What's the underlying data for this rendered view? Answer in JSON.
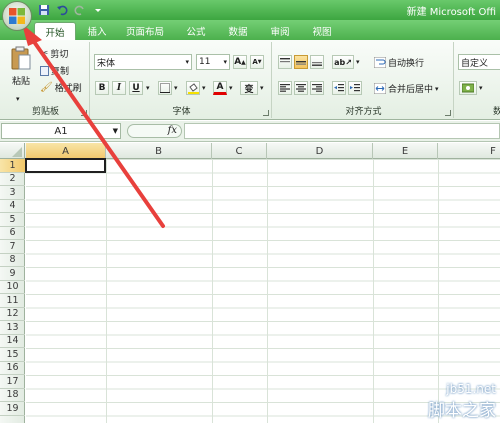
{
  "window": {
    "title": "新建 Microsoft Offi"
  },
  "tabs": [
    "开始",
    "插入",
    "页面布局",
    "公式",
    "数据",
    "审阅",
    "视图"
  ],
  "clipboard": {
    "paste": "粘贴",
    "cut": "剪切",
    "copy": "复制",
    "format_painter": "格式刷",
    "group": "剪贴板"
  },
  "font": {
    "name": "宋体",
    "size": "11",
    "bold": "B",
    "italic": "I",
    "underline": "U",
    "grow": "A",
    "shrink": "A",
    "font_color": "A",
    "phonetic": "变",
    "group": "字体"
  },
  "alignment": {
    "wrap_text": "自动换行",
    "merge_center": "合并后居中",
    "group": "对齐方式"
  },
  "number": {
    "format": "自定义",
    "group": "数"
  },
  "formula_bar": {
    "name_box": "A1",
    "fx": "fx"
  },
  "columns": [
    "A",
    "B",
    "C",
    "D",
    "E",
    "F"
  ],
  "rows": [
    "1",
    "2",
    "3",
    "4",
    "5",
    "6",
    "7",
    "8",
    "9",
    "10",
    "11",
    "12",
    "13",
    "14",
    "15",
    "16",
    "17",
    "18",
    "19"
  ],
  "watermark": {
    "site": "jb51.net",
    "name": "脚本之家"
  },
  "colors": {
    "tab_bar": "#4cb04d",
    "annotation_arrow": "#e8403c"
  }
}
